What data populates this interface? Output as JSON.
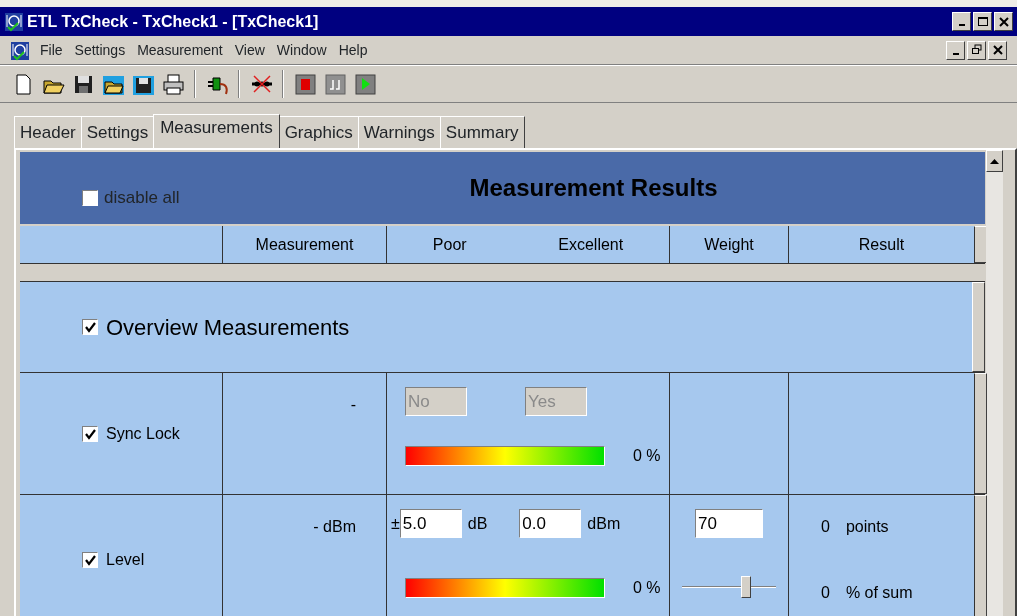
{
  "window": {
    "title": "ETL TxCheck - TxCheck1 - [TxCheck1]"
  },
  "menu": [
    "File",
    "Settings",
    "Measurement",
    "View",
    "Window",
    "Help"
  ],
  "tabs": [
    {
      "label": "Header",
      "selected": false
    },
    {
      "label": "Settings",
      "selected": false
    },
    {
      "label": "Measurements",
      "selected": true
    },
    {
      "label": "Graphics",
      "selected": false
    },
    {
      "label": "Warnings",
      "selected": false
    },
    {
      "label": "Summary",
      "selected": false
    }
  ],
  "results": {
    "title": "Measurement Results",
    "disable_all": {
      "label": "disable all",
      "checked": false
    },
    "columns": [
      "Measurement",
      "Poor",
      "Excellent",
      "Weight",
      "Result"
    ],
    "group": {
      "label": "Overview Measurements",
      "checked": true
    },
    "rows": [
      {
        "kind": "boolean",
        "label": "Sync Lock",
        "checked": true,
        "measurement": "-",
        "poor": {
          "value": "No",
          "disabled": true
        },
        "excellent": {
          "value": "Yes",
          "disabled": true
        },
        "rating": "0 %"
      },
      {
        "kind": "numeric",
        "label": "Level",
        "checked": true,
        "measurement": "- dBm",
        "poor": {
          "prefix": "±",
          "value": "5.0",
          "unit": "dB",
          "disabled": false
        },
        "excellent": {
          "value": "0.0",
          "unit": "dBm",
          "disabled": false
        },
        "rating": "0 %",
        "weight": {
          "value": "70",
          "level": 0.68
        },
        "points": {
          "value": "0",
          "unit": "points"
        },
        "share": {
          "value": "0",
          "unit": "% of sum"
        }
      }
    ]
  }
}
